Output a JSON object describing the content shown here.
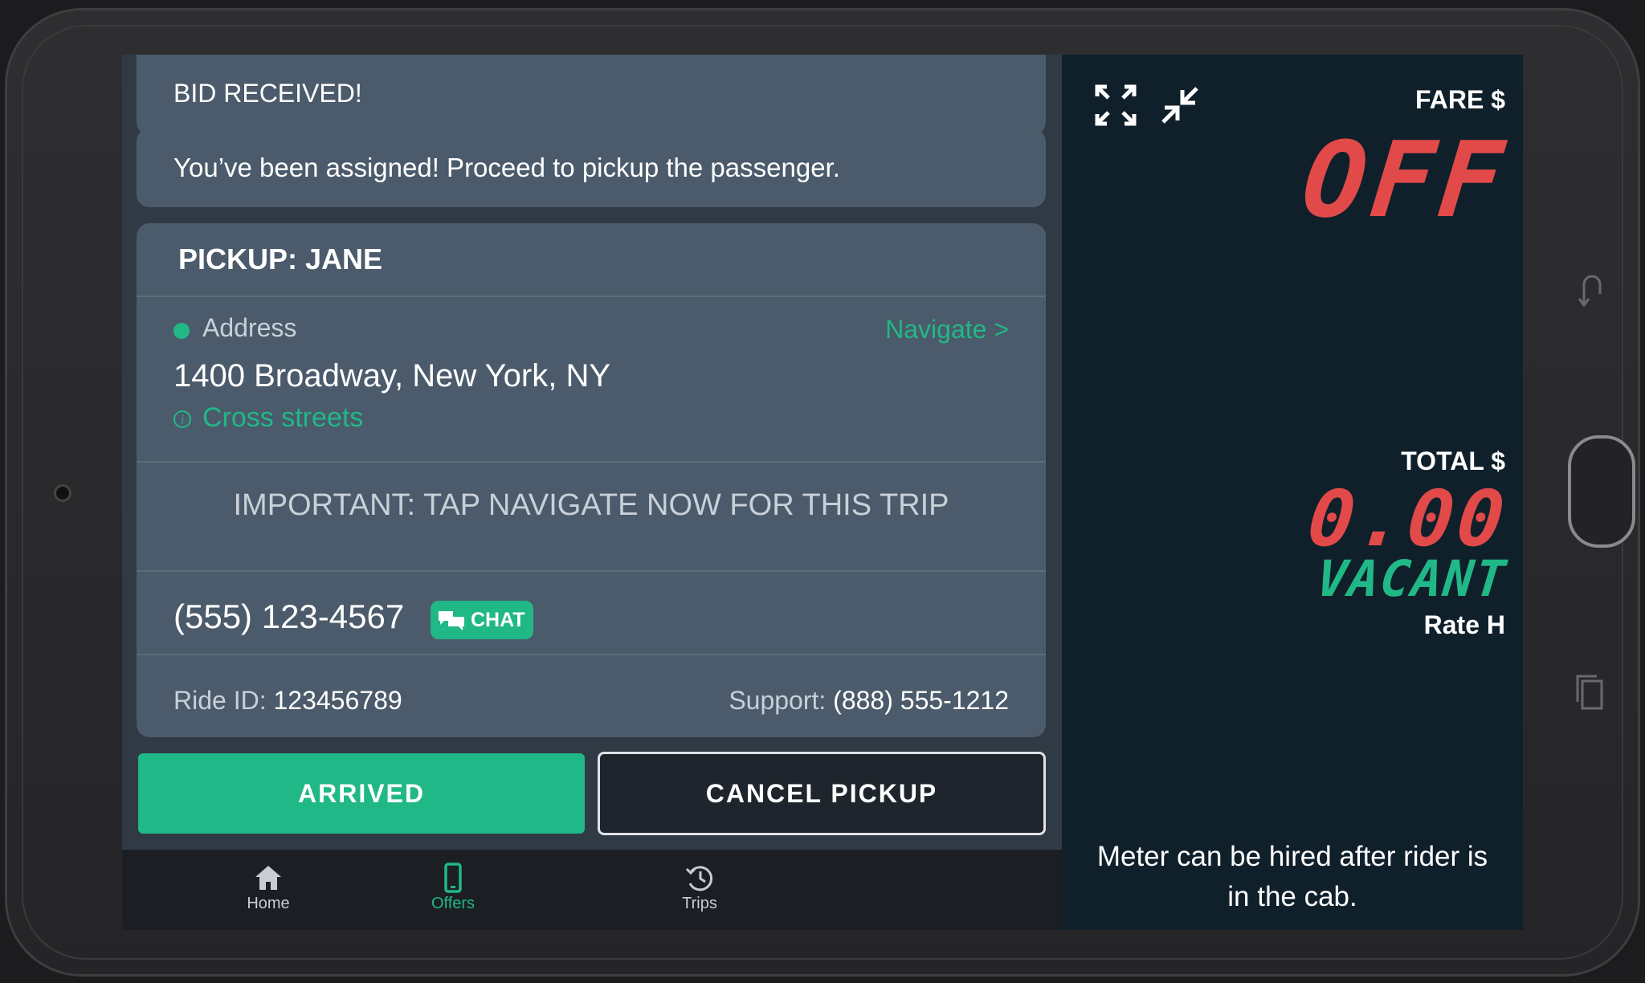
{
  "cards": {
    "bid_text": "BID RECEIVED!",
    "assigned_text": "You’ve been assigned! Proceed to pickup the passenger."
  },
  "pickup": {
    "title": "PICKUP: JANE",
    "address_label": "Address",
    "navigate_link": "Navigate >",
    "address_value": "1400 Broadway, New York, NY",
    "cross_streets_link": "Cross streets",
    "important_notice": "IMPORTANT: TAP NAVIGATE NOW FOR THIS TRIP",
    "phone": "(555) 123-4567",
    "chat_label": "CHAT",
    "ride_id_label": "Ride ID:",
    "ride_id_value": "123456789",
    "support_label": "Support:",
    "support_value": "(888) 555-1212"
  },
  "actions": {
    "arrived_label": "ARRIVED",
    "cancel_label": "CANCEL PICKUP"
  },
  "nav": {
    "items": [
      {
        "label": "Home",
        "icon": "home-icon",
        "active": false
      },
      {
        "label": "Offers",
        "icon": "phone-icon",
        "active": true
      },
      {
        "label": "Trips",
        "icon": "history-icon",
        "active": false
      }
    ]
  },
  "meter": {
    "fare_label": "FARE $",
    "fare_value": "OFF",
    "total_label": "TOTAL $",
    "total_value": "0.00",
    "status": "VACANT",
    "rate": "Rate H",
    "note": "Meter can be hired after rider is in the cab."
  },
  "colors": {
    "accent_green": "#21b887",
    "meter_red": "#e24a4a",
    "card_bg": "#4b5b6b",
    "meter_bg": "#10202b"
  }
}
